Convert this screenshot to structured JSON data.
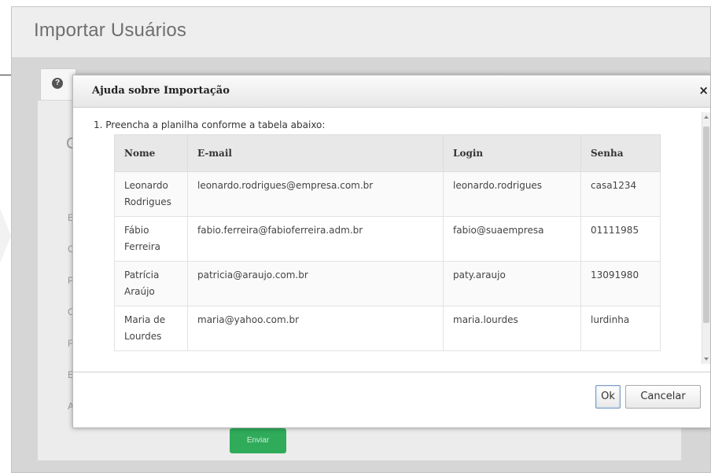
{
  "background": {
    "title": "Importar Usuários",
    "tab_icon": "?",
    "side_letters": [
      "C",
      "E",
      "C",
      "P",
      "C",
      "F",
      "E",
      "A"
    ],
    "send_label": "Enviar"
  },
  "dialog": {
    "title": "Ajuda sobre Importação",
    "close_label": "×",
    "instruction": "1.  Preencha a planilha conforme a tabela abaixo:",
    "table": {
      "headers": [
        "Nome",
        "E-mail",
        "Login",
        "Senha"
      ],
      "rows": [
        [
          "Leonardo Rodrigues",
          "leonardo.rodrigues@empresa.com.br",
          "leonardo.rodrigues",
          "casa1234"
        ],
        [
          "Fábio Ferreira",
          "fabio.ferreira@fabioferreira.adm.br",
          "fabio@suaempresa",
          "01111985"
        ],
        [
          "Patrícia Araújo",
          "patricia@araujo.com.br",
          "paty.araujo",
          "13091980"
        ],
        [
          "Maria de Lourdes",
          "maria@yahoo.com.br",
          "maria.lourdes",
          "lurdinha"
        ]
      ]
    },
    "ok_label": "Ok",
    "cancel_label": "Cancelar"
  }
}
